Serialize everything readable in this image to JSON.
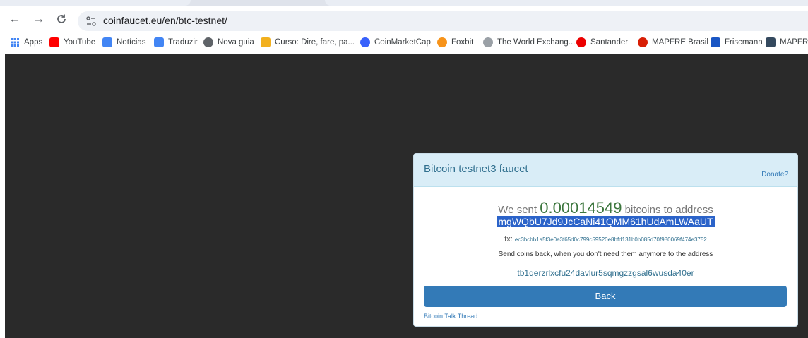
{
  "browser": {
    "nav": {
      "back_glyph": "←",
      "forward_glyph": "→",
      "reload_glyph": "C"
    },
    "url": "coinfaucet.eu/en/btc-testnet/",
    "bookmarks": [
      {
        "label": "Apps",
        "icon": "apps-grid-icon",
        "color": "#4285f4"
      },
      {
        "label": "YouTube",
        "icon": "youtube-icon",
        "color": "#ff0000"
      },
      {
        "label": "Notícias",
        "icon": "news-icon",
        "color": "#4285f4"
      },
      {
        "label": "Traduzir",
        "icon": "translate-icon",
        "color": "#4285f4"
      },
      {
        "label": "Nova guia",
        "icon": "globe-icon",
        "color": "#5f6368"
      },
      {
        "label": "Curso: Dire, fare, pa...",
        "icon": "usp-icon",
        "color": "#f2b01e"
      },
      {
        "label": "CoinMarketCap",
        "icon": "coinmarketcap-icon",
        "color": "#3861fb"
      },
      {
        "label": "Foxbit",
        "icon": "foxbit-icon",
        "color": "#f7931a"
      },
      {
        "label": "The World Exchang...",
        "icon": "world-exchange-icon",
        "color": "#9aa0a6"
      },
      {
        "label": "Santander",
        "icon": "santander-icon",
        "color": "#ec0000"
      },
      {
        "label": "MAPFRE Brasil",
        "icon": "mapfre-icon",
        "color": "#d81e05"
      },
      {
        "label": "Friscmann",
        "icon": "friscmann-icon",
        "color": "#1a56c4"
      },
      {
        "label": "MAPFRE",
        "icon": "mapfre-bookmark-icon",
        "color": "#34495e"
      }
    ]
  },
  "faucet": {
    "title": "Bitcoin testnet3 faucet",
    "donate": "Donate?",
    "sent_prefix": "We sent ",
    "amount": "0.00014549",
    "sent_suffix": " bitcoins to address",
    "address": "mgWQbU7Jd9JcCaNi41QMM61hUdAmLWAaUT",
    "tx_label": "tx: ",
    "tx_hash": "ec3bcbb1a5f3e0e3f65d0c799c59520e8bfd131b0b085d70f980069f474e3752",
    "send_back_note": "Send coins back, when you don't need them anymore to the address",
    "return_address": "tb1qerzrlxcfu24davlur5sqmgzzgsal6wusda40er",
    "back_label": "Back",
    "talk_link": "Bitcoin Talk Thread",
    "colors": {
      "header_bg": "#d9edf7",
      "amount": "#3c763d",
      "button": "#337ab7",
      "highlight": "#2b63c9"
    }
  }
}
